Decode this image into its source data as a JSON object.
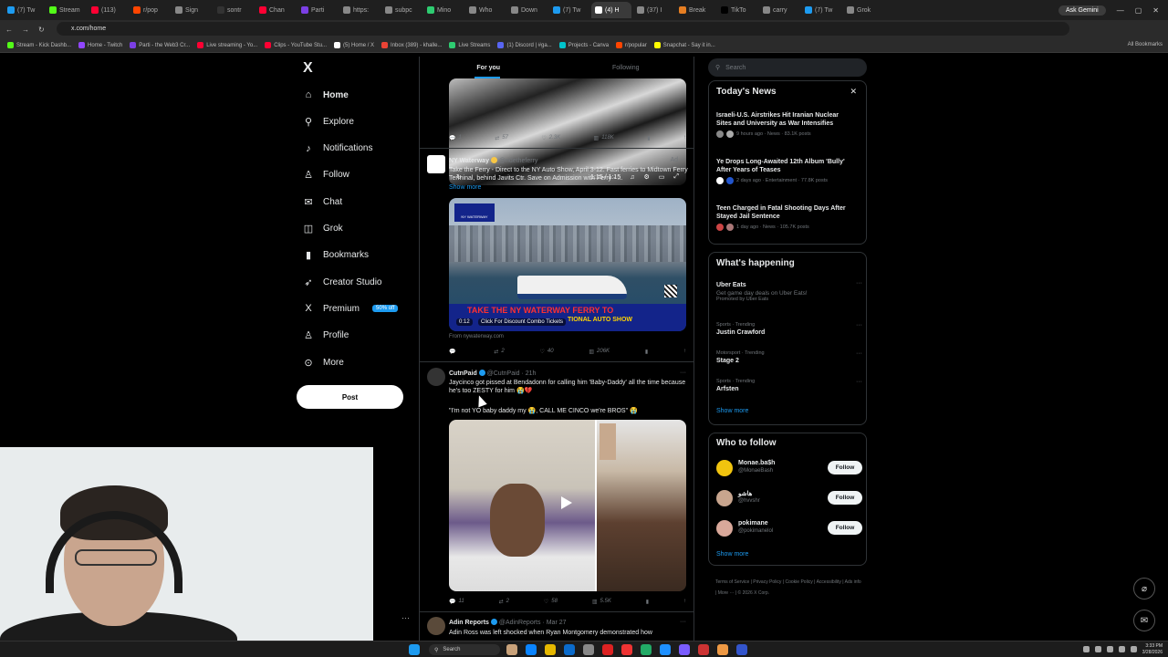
{
  "browser": {
    "tabs": [
      {
        "label": "(7) Tw",
        "color": "#1d9bf0"
      },
      {
        "label": "Stream",
        "color": "#53fc18"
      },
      {
        "label": "(113)",
        "color": "#ff0033"
      },
      {
        "label": "r/pop",
        "color": "#ff4500"
      },
      {
        "label": "Sign",
        "color": "#888888"
      },
      {
        "label": "sontr",
        "color": "#333333"
      },
      {
        "label": "Chan",
        "color": "#ff0033"
      },
      {
        "label": "Parti",
        "color": "#7b3fe4"
      },
      {
        "label": "https:",
        "color": "#888888"
      },
      {
        "label": "subpc",
        "color": "#888888"
      },
      {
        "label": "Mino",
        "color": "#2ecc71"
      },
      {
        "label": "Who",
        "color": "#888888"
      },
      {
        "label": "Down",
        "color": "#888888"
      },
      {
        "label": "(7) Tw",
        "color": "#1d9bf0"
      },
      {
        "label": "(4) H",
        "color": "#ffffff"
      },
      {
        "label": "(37) I",
        "color": "#888888"
      },
      {
        "label": "Break",
        "color": "#e67e22"
      },
      {
        "label": "TikTo",
        "color": "#000000"
      },
      {
        "label": "carry",
        "color": "#888888"
      },
      {
        "label": "(7) Tw",
        "color": "#1d9bf0"
      },
      {
        "label": "Grok",
        "color": "#888888"
      }
    ],
    "active_tab_index": 14,
    "ask_gemini": "Ask Gemini",
    "url": "x.com/home",
    "bookmarks": [
      {
        "label": "Stream - Kick Dashb...",
        "color": "#53fc18"
      },
      {
        "label": "Home - Twitch",
        "color": "#9146ff"
      },
      {
        "label": "Parti - the Web3 Cr...",
        "color": "#7b3fe4"
      },
      {
        "label": "Live streaming - Yo...",
        "color": "#ff0033"
      },
      {
        "label": "Clips - YouTube Stu...",
        "color": "#ff0033"
      },
      {
        "label": "(5) Home / X",
        "color": "#ffffff"
      },
      {
        "label": "Inbox (389) - khalle...",
        "color": "#ea4335"
      },
      {
        "label": "Live Streams",
        "color": "#2ecc71"
      },
      {
        "label": "(1) Discord | #ga...",
        "color": "#5865f2"
      },
      {
        "label": "Projects - Canva",
        "color": "#00c4cc"
      },
      {
        "label": "r/popular",
        "color": "#ff4500"
      },
      {
        "label": "Snapchat - Say it in...",
        "color": "#fffc00"
      }
    ],
    "all_bookmarks": "All Bookmarks"
  },
  "nav": {
    "items": [
      {
        "label": "Home",
        "icon": "home-icon",
        "glyph": "⌂"
      },
      {
        "label": "Explore",
        "icon": "search-icon",
        "glyph": "⚲"
      },
      {
        "label": "Notifications",
        "icon": "bell-icon",
        "glyph": "♪"
      },
      {
        "label": "Follow",
        "icon": "person-add-icon",
        "glyph": "♙"
      },
      {
        "label": "Chat",
        "icon": "mail-icon",
        "glyph": "✉"
      },
      {
        "label": "Grok",
        "icon": "grok-icon",
        "glyph": "◫"
      },
      {
        "label": "Bookmarks",
        "icon": "bookmark-icon",
        "glyph": "▮"
      },
      {
        "label": "Creator Studio",
        "icon": "rocket-icon",
        "glyph": "➶"
      },
      {
        "label": "Premium",
        "icon": "x-icon",
        "glyph": "X"
      },
      {
        "label": "Profile",
        "icon": "person-icon",
        "glyph": "♙"
      },
      {
        "label": "More",
        "icon": "more-circle-icon",
        "glyph": "⊙"
      }
    ],
    "premium_badge": "50% off",
    "post_label": "Post"
  },
  "feed": {
    "tabs": [
      "For you",
      "Following"
    ],
    "top_video": {
      "time": "1:15 / 1:15"
    },
    "top_actions": {
      "replies": "1",
      "reposts": "57",
      "likes": "2.3K",
      "views": "118K"
    },
    "ad": {
      "name": "NY Waterway",
      "handle": "@ridetheferry",
      "ad_label": "Ad",
      "text": "Take the Ferry - Direct to the NY Auto Show, April 3-12. Fast ferries to Midtown Ferry Terminal, behind Javits Ctr. Save on Admission with Ferry - ...",
      "show_more": "Show more",
      "logo_text": "NY WATERWAY",
      "banner_red": "TAKE THE NY WATERWAY FERRY TO",
      "banner_yellow": "TIONAL AUTO SHOW",
      "video_time": "0:12",
      "cta": "Click For Discount Combo Tickets",
      "from": "From nywaterway.com",
      "actions": {
        "replies": "",
        "reposts": "2",
        "likes": "40",
        "views": "206K"
      }
    },
    "tweet2": {
      "name": "CutnPaid",
      "handle": "@CutnPaid",
      "time": "· 21h",
      "text": "Jaycinco got pissed at Bendadonn for calling him 'Baby-Daddy' all the time because he's too ZESTY for him 😭💔",
      "quote": "\"I'm not YO baby daddy my 😭, CALL ME CINCO we're BROS\" 😭",
      "actions": {
        "replies": "11",
        "reposts": "2",
        "likes": "58",
        "views": "5.5K"
      }
    },
    "tweet3": {
      "name": "Adin Reports",
      "handle": "@AdinReports",
      "time": "· Mar 27",
      "text": "Adin Ross was left shocked when Ryan Montgomery demonstrated how"
    }
  },
  "sidebar": {
    "search_placeholder": "Search",
    "news_title": "Today's News",
    "news": [
      {
        "headline": "Israeli-U.S. Airstrikes Hit Iranian Nuclear Sites and University as War Intensifies",
        "meta": "9 hours ago · News · 83.1K posts"
      },
      {
        "headline": "Ye Drops Long-Awaited 12th Album 'Bully' After Years of Teases",
        "meta": "2 days ago · Entertainment · 77.8K posts"
      },
      {
        "headline": "Teen Charged in Fatal Shooting Days After Stayed Jail Sentence",
        "meta": "1 day ago · News · 105.7K posts"
      }
    ],
    "happening_title": "What's happening",
    "trends": [
      {
        "category": "",
        "title": "Uber Eats",
        "desc": "Get game day deals on Uber Eats!",
        "promo": "Promoted by Uber Eats"
      },
      {
        "category": "Sports · Trending",
        "title": "Justin Crawford",
        "desc": "",
        "promo": ""
      },
      {
        "category": "Motorsport · Trending",
        "title": "Stage 2",
        "desc": "",
        "promo": ""
      },
      {
        "category": "Sports · Trending",
        "title": "Arfsten",
        "desc": "",
        "promo": ""
      }
    ],
    "show_more": "Show more",
    "wtf_title": "Who to follow",
    "follows": [
      {
        "name": "Monae.ba$h",
        "handle": "@MonaeBash",
        "color": "#f1c40f"
      },
      {
        "name": "هاشو",
        "handle": "@hvvshr",
        "color": "#c8a58e"
      },
      {
        "name": "pokimane",
        "handle": "@pokimanelol",
        "color": "#d9a89a"
      }
    ],
    "follow_label": "Follow",
    "footer": "Terms of Service | Privacy Policy | Cookie Policy | Accessibility | Ads info | More ··· | © 2026 X Corp."
  },
  "taskbar": {
    "search": "Search",
    "time": "3:33 PM",
    "date": "3/28/2026"
  }
}
